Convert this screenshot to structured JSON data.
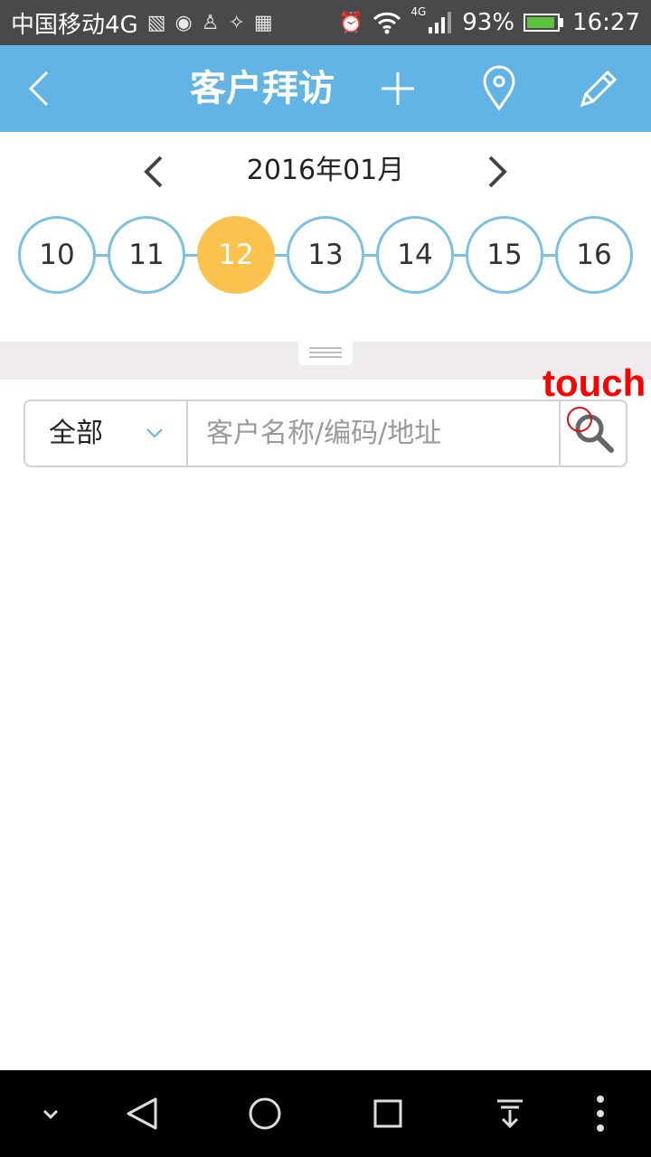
{
  "status_bar": {
    "carrier": "中国移动4G",
    "network": "4G",
    "battery_percent": "93%",
    "battery_level": 0.93,
    "time": "16:27",
    "icons": [
      "image-notification-icon",
      "voicemail-icon",
      "android-icon",
      "app-notification-icon",
      "keyboard-icon",
      "alarm-icon",
      "wifi-icon",
      "signal-icon",
      "battery-icon"
    ]
  },
  "app_bar": {
    "title": "客户拜访",
    "accent_color": "#62b4e4",
    "icons": [
      "back-icon",
      "plus-icon",
      "location-pin-icon",
      "edit-icon"
    ]
  },
  "calendar": {
    "month_label": "2016年01月",
    "days": [
      "10",
      "11",
      "12",
      "13",
      "14",
      "15",
      "16"
    ],
    "selected_day": "12",
    "selected_color": "#fbc24e"
  },
  "search": {
    "filter_label": "全部",
    "placeholder": "客户名称/编码/地址",
    "value": ""
  },
  "overlay": {
    "touch_label": "touch"
  },
  "nav_bar": {
    "icons": [
      "chevron-down-icon",
      "back-triangle-icon",
      "home-circle-icon",
      "recents-square-icon",
      "notification-pull-icon",
      "more-vert-icon"
    ]
  }
}
